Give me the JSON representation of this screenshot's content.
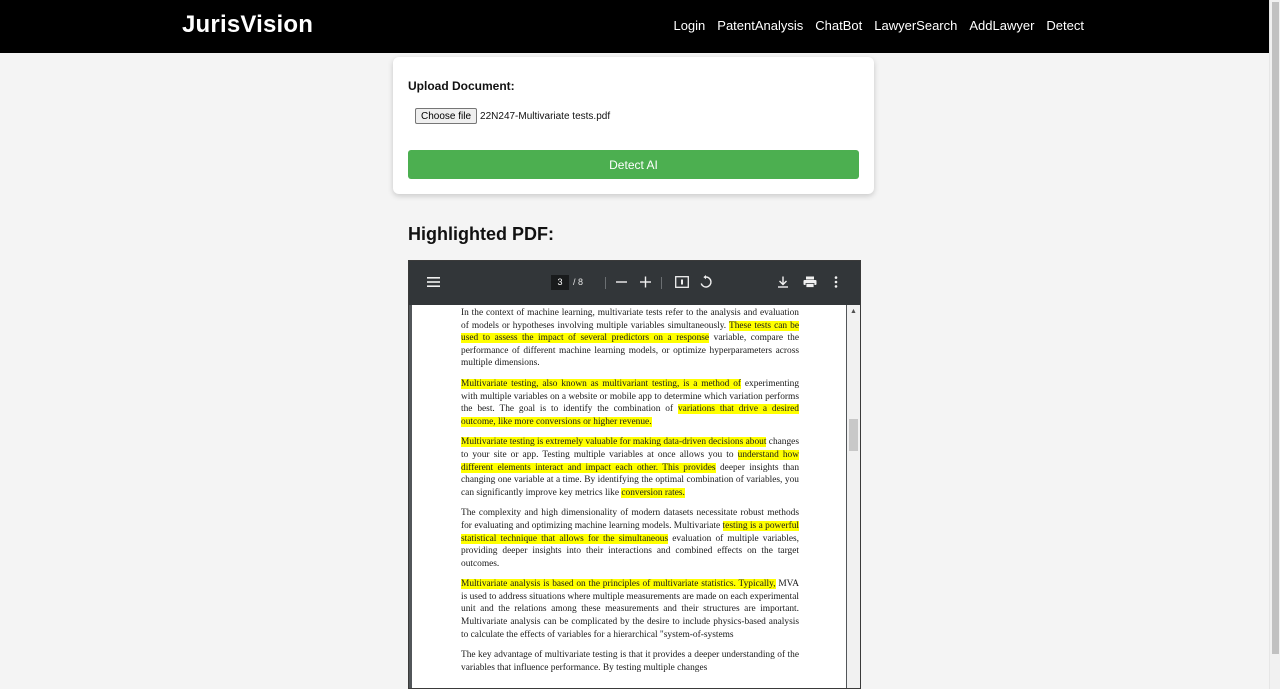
{
  "navbar": {
    "brand": "JurisVision",
    "links": [
      "Login",
      "PatentAnalysis",
      "ChatBot",
      "LawyerSearch",
      "AddLawyer",
      "Detect"
    ]
  },
  "upload": {
    "label": "Upload Document:",
    "choose_button": "Choose file",
    "file_name": "22N247-Multivariate tests.pdf",
    "detect_button": "Detect AI"
  },
  "highlighted_heading": "Highlighted PDF:",
  "pdf_viewer": {
    "current_page": "3",
    "page_total": "/ 8",
    "icons": [
      "menu-icon",
      "zoom-out-icon",
      "zoom-in-icon",
      "fit-page-icon",
      "rotate-icon",
      "download-icon",
      "print-icon",
      "more-options-icon"
    ],
    "paragraphs": [
      [
        {
          "text": "In the context of machine learning, multivariate tests refer to the analysis and evaluation of models or hypotheses involving multiple variables simultaneously. ",
          "hl": false
        },
        {
          "text": "These tests can be used to assess the impact of several predictors on a response",
          "hl": true
        },
        {
          "text": " variable, compare the performance of different machine learning models, or optimize hyperparameters across multiple dimensions.",
          "hl": false
        }
      ],
      [
        {
          "text": "Multivariate testing, also known as multivariant testing, is a method of",
          "hl": true
        },
        {
          "text": " experimenting with multiple variables on a website or mobile app to determine which variation performs the best. The goal is to identify the combination of ",
          "hl": false
        },
        {
          "text": "variations that drive a desired outcome, like more conversions or higher revenue.",
          "hl": true
        }
      ],
      [
        {
          "text": "Multivariate testing is extremely valuable for making data-driven decisions about",
          "hl": true
        },
        {
          "text": " changes to your site or app. Testing multiple variables at once allows you to ",
          "hl": false
        },
        {
          "text": "understand how different elements interact and impact each other. This provides",
          "hl": true
        },
        {
          "text": " deeper insights than changing one variable at a time. By identifying the optimal combination of variables, you can significantly improve key metrics like ",
          "hl": false
        },
        {
          "text": "conversion rates.",
          "hl": true
        }
      ],
      [
        {
          "text": "The complexity and high dimensionality of modern datasets necessitate robust methods for evaluating and optimizing machine learning models. Multivariate ",
          "hl": false
        },
        {
          "text": "testing is a powerful statistical technique that allows for the simultaneous",
          "hl": true
        },
        {
          "text": " evaluation of multiple variables, providing deeper insights into their interactions and combined effects on the target outcomes.",
          "hl": false
        }
      ],
      [
        {
          "text": "Multivariate analysis is based on the principles of multivariate statistics. Typically,",
          "hl": true
        },
        {
          "text": " MVA is used to address situations where multiple measurements are made on each experimental unit and the relations among these measurements and their structures are important. Multivariate analysis can be complicated by the desire to include physics-based analysis to calculate the effects of variables for a hierarchical \"system-of-systems",
          "hl": false
        }
      ],
      [
        {
          "text": "The key advantage of multivariate testing is that it provides a deeper understanding of the variables that influence performance. By testing multiple changes",
          "hl": false
        }
      ]
    ]
  }
}
